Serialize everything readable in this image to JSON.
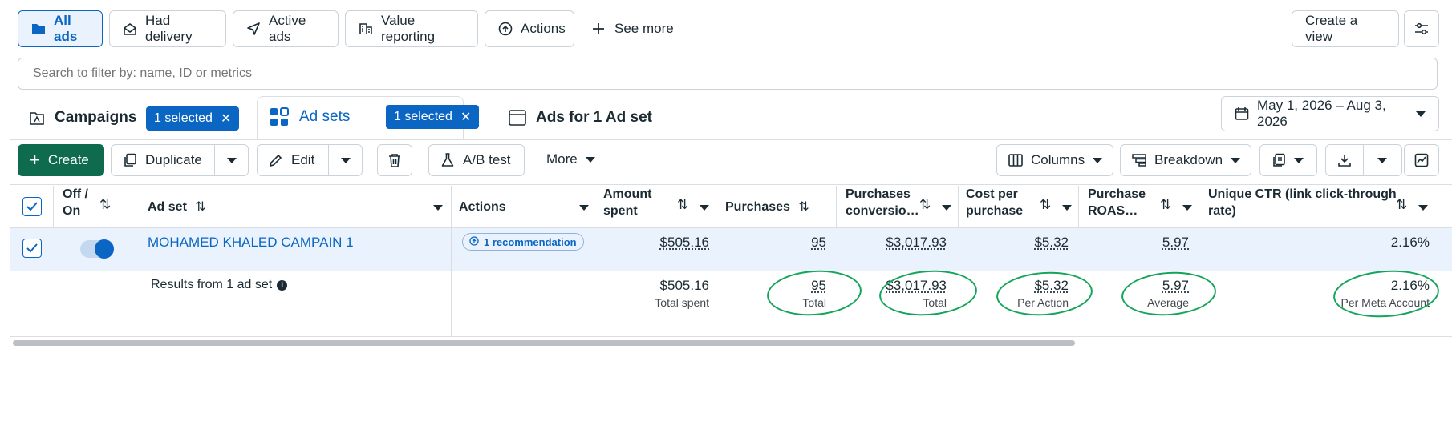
{
  "filters": {
    "all_ads": "All ads",
    "had_delivery": "Had delivery",
    "active_ads": "Active ads",
    "value_reporting": "Value reporting",
    "actions": "Actions",
    "see_more": "See more",
    "create_view": "Create a view"
  },
  "search": {
    "placeholder": "Search to filter by: name, ID or metrics"
  },
  "tabs": {
    "campaigns": "Campaigns",
    "campaigns_selected": "1 selected",
    "ad_sets": "Ad sets",
    "ad_sets_selected": "1 selected",
    "ads": "Ads for 1 Ad set"
  },
  "date_range": "May 1, 2026 – Aug 3, 2026",
  "toolbar": {
    "create": "Create",
    "duplicate": "Duplicate",
    "edit": "Edit",
    "ab_test": "A/B test",
    "more": "More",
    "columns": "Columns",
    "breakdown": "Breakdown"
  },
  "table": {
    "headers": {
      "off_on_1": "Off /",
      "off_on_2": "On",
      "ad_set": "Ad set",
      "actions": "Actions",
      "amount_spent_1": "Amount",
      "amount_spent_2": "spent",
      "purchases": "Purchases",
      "purchases_conv_1": "Purchases",
      "purchases_conv_2": "conversio…",
      "cost_per_purchase_1": "Cost per",
      "cost_per_purchase_2": "purchase",
      "purchase_roas_1": "Purchase",
      "purchase_roas_2": "ROAS…",
      "unique_ctr_1": "Unique CTR (link click-through",
      "unique_ctr_2": "rate)"
    },
    "row": {
      "name": "MOHAMED KHALED CAMPAIN 1",
      "recommendation": "1 recommendation",
      "amount_spent": "$505.16",
      "purchases": "95",
      "purchases_conv": "$3,017.93",
      "cost_per_purchase": "$5.32",
      "purchase_roas": "5.97",
      "unique_ctr": "2.16%"
    },
    "summary": {
      "label": "Results from 1 ad set",
      "amount_spent": "$505.16",
      "amount_spent_sub": "Total spent",
      "purchases": "95",
      "purchases_sub": "Total",
      "purchases_conv": "$3,017.93",
      "purchases_conv_sub": "Total",
      "cost_per_purchase": "$5.32",
      "cost_per_purchase_sub": "Per Action",
      "purchase_roas": "5.97",
      "purchase_roas_sub": "Average",
      "unique_ctr": "2.16%",
      "unique_ctr_sub": "Per Meta Account"
    }
  },
  "colors": {
    "accent": "#0a66c2",
    "create_green": "#0e6b4d",
    "annotation_green": "#14a45a"
  }
}
